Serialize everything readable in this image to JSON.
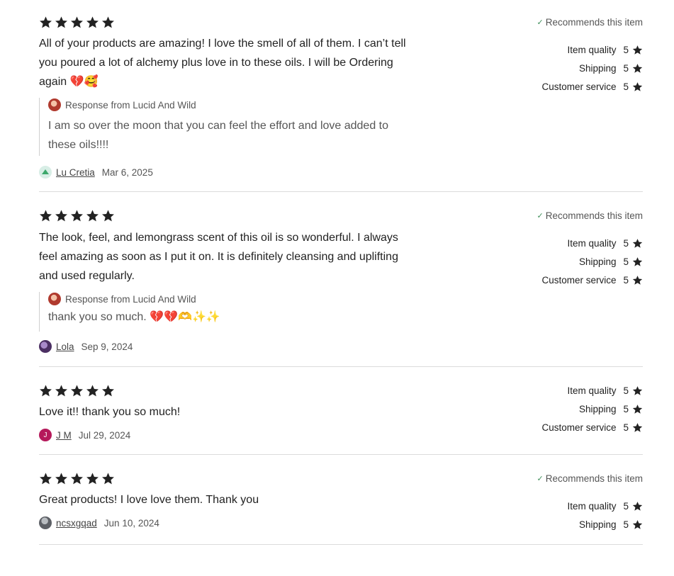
{
  "reviews": [
    {
      "stars": 5,
      "text": "All of your products are amazing! I love the smell of all of them. I can’t tell you poured a lot of alchemy plus love in to these oils. I will be Ordering again 💔🥰",
      "response_label": "Response from Lucid And Wild",
      "response_text": "I am so over the moon that you can feel the effort and love added to these oils!!!!",
      "author": "Lu Cretia",
      "date": "Mar 6, 2025",
      "recommends": "Recommends this item",
      "ratings": [
        {
          "label": "Item quality",
          "value": "5"
        },
        {
          "label": "Shipping",
          "value": "5"
        },
        {
          "label": "Customer service",
          "value": "5"
        }
      ]
    },
    {
      "stars": 5,
      "text": "The look, feel, and lemongrass scent of this oil is so wonderful. I always feel amazing as soon as I put it on. It is definitely cleansing and uplifting and used regularly.",
      "response_label": "Response from Lucid And Wild",
      "response_text": "thank you so much. 💔💔🫶✨✨",
      "author": "Lola",
      "date": "Sep 9, 2024",
      "recommends": "Recommends this item",
      "ratings": [
        {
          "label": "Item quality",
          "value": "5"
        },
        {
          "label": "Shipping",
          "value": "5"
        },
        {
          "label": "Customer service",
          "value": "5"
        }
      ]
    },
    {
      "stars": 5,
      "text": "Love it!! thank you so much!",
      "author": "J M",
      "author_initial": "J",
      "date": "Jul 29, 2024",
      "ratings": [
        {
          "label": "Item quality",
          "value": "5"
        },
        {
          "label": "Shipping",
          "value": "5"
        },
        {
          "label": "Customer service",
          "value": "5"
        }
      ]
    },
    {
      "stars": 5,
      "text": "Great products! I love love them. Thank you",
      "author": "ncsxgqad",
      "date": "Jun 10, 2024",
      "recommends": "Recommends this item",
      "ratings": [
        {
          "label": "Item quality",
          "value": "5"
        },
        {
          "label": "Shipping",
          "value": "5"
        }
      ]
    }
  ],
  "colors": {
    "star": "#222222",
    "divider": "#dcdcdc",
    "check": "#3f8f5a",
    "avatar_jm": "#b5195b"
  }
}
